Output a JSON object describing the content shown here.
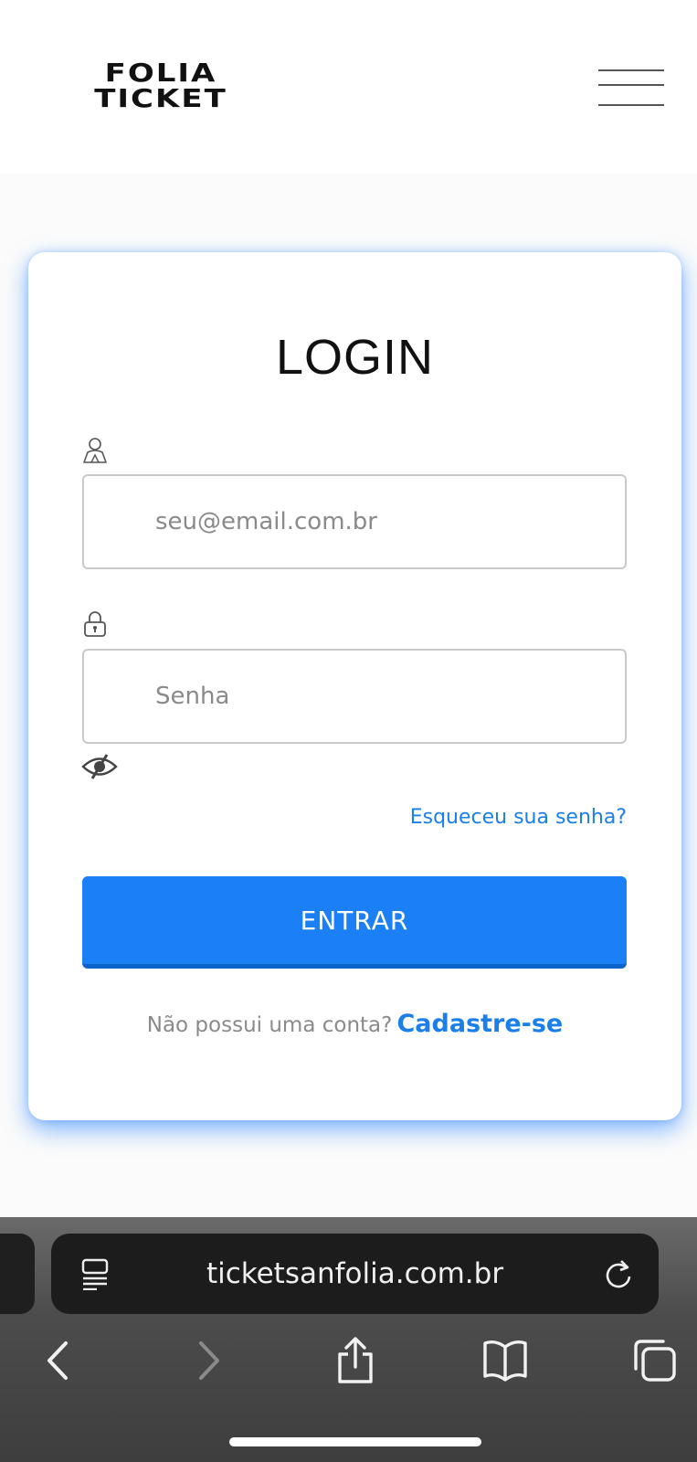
{
  "header": {
    "logo_line1": "FOLIA",
    "logo_line2": "TICKET",
    "menu_icon": "hamburger-menu-icon"
  },
  "login": {
    "title": "LOGIN",
    "email_placeholder": "seu@email.com.br",
    "email_icon": "user-icon",
    "password_placeholder": "Senha",
    "password_icon": "lock-icon",
    "show_password_icon": "eye-slash-icon",
    "forgot_password": "Esqueceu sua senha?",
    "submit_label": "ENTRAR",
    "no_account_text": "Não possui uma conta?",
    "signup_link": "Cadastre-se"
  },
  "browser": {
    "url": "ticketsanfolia.com.br",
    "icons": [
      "reader-icon",
      "reload-icon",
      "back-icon",
      "forward-icon",
      "share-icon",
      "bookmarks-icon",
      "tabs-icon"
    ]
  },
  "colors": {
    "accent": "#1b7ff5",
    "link": "#1a7fe8",
    "card_glow": "#1478ff"
  }
}
